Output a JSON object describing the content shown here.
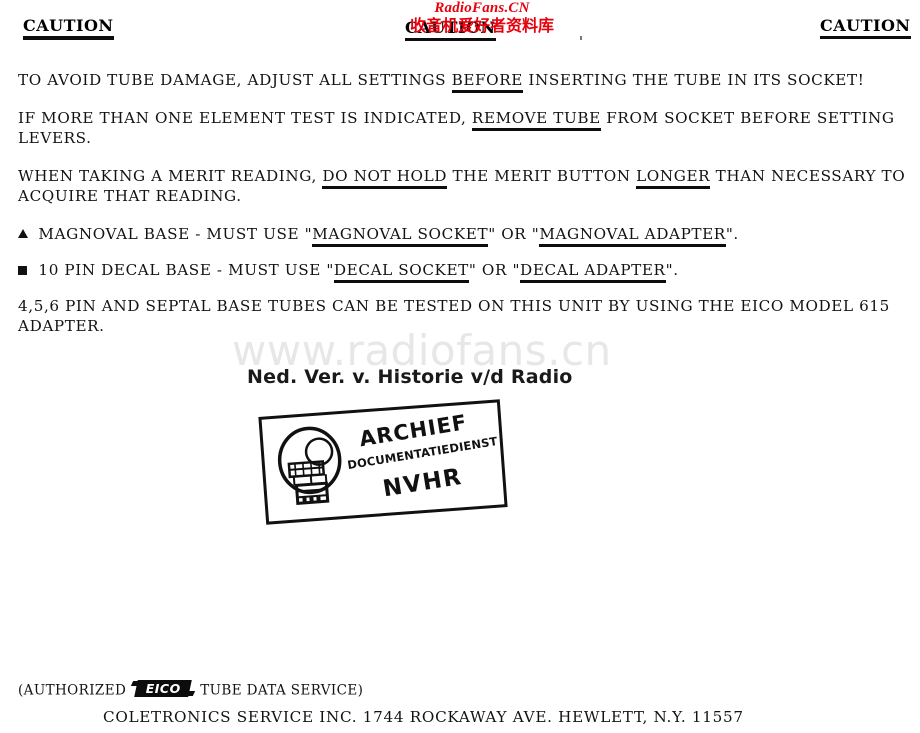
{
  "header": {
    "caution_left": "CAUTION",
    "caution_center": "CAUTION",
    "caution_right": "CAUTION"
  },
  "watermarks": {
    "red_latin": "RadioFans.CN",
    "red_cjk": "收音机爱好者资料库",
    "grey_url": "www.radiofans.cn",
    "red_color": "#e8000d",
    "grey_color": "#e7e7e9"
  },
  "body": {
    "p1": {
      "before": "TO AVOID TUBE DAMAGE, ADJUST ALL SETTINGS ",
      "underlined": "BEFORE",
      "after": " INSERTING THE TUBE IN ITS SOCKET!"
    },
    "p2": {
      "before": "IF MORE THAN ONE ELEMENT TEST IS INDICATED, ",
      "underlined": "REMOVE TUBE",
      "after": " FROM SOCKET BEFORE SETTING LEVERS."
    },
    "p3": {
      "before": "WHEN TAKING A MERIT READING, ",
      "underlined1": "DO NOT HOLD",
      "middle": " THE MERIT BUTTON ",
      "underlined2": "LONGER",
      "after": " THAN NECESSARY TO ACQUIRE THAT READING."
    },
    "p4": {
      "marker": "triangle-bullet",
      "before": " MAGNOVAL BASE - MUST USE \"",
      "underlined1": "MAGNOVAL SOCKET",
      "middle": "\" OR \"",
      "underlined2": "MAGNOVAL ADAPTER",
      "after": "\"."
    },
    "p5": {
      "marker": "square-bullet",
      "before": " 10 PIN DECAL BASE - MUST USE \"",
      "underlined1": "DECAL SOCKET",
      "middle": "\" OR \"",
      "underlined2": "DECAL ADAPTER",
      "after": "\"."
    },
    "p6": {
      "text": "4,5,6 PIN AND SEPTAL BASE TUBES CAN BE TESTED ON THIS UNIT BY USING THE EICO MODEL 615 ADAPTER."
    }
  },
  "nvhr": {
    "caption": "Ned. Ver. v. Historie v/d Radio",
    "stamp_line1": "ARCHIEF",
    "stamp_line2": "DOCUMENTATIEDIENST",
    "stamp_line3": "NVHR"
  },
  "footer": {
    "authorized_open": "(AUTHORIZED",
    "logo_text": "EICO",
    "authorized_close": "TUBE DATA SERVICE)",
    "address": "COLETRONICS SERVICE INC. 1744 ROCKAWAY AVE.   HEWLETT, N.Y. 11557"
  }
}
